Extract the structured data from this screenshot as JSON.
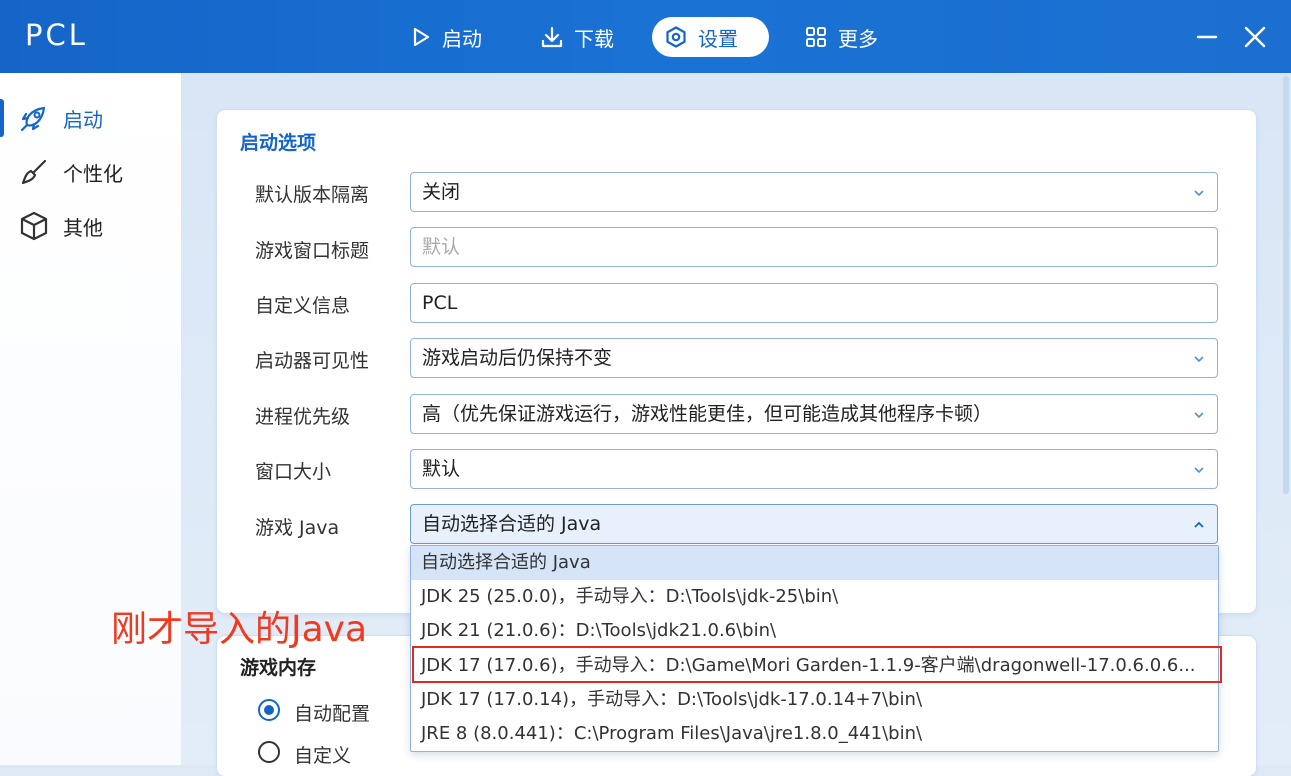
{
  "app": {
    "title": "PCL"
  },
  "nav": {
    "tabs": [
      {
        "label": "启动",
        "icon": "play-icon"
      },
      {
        "label": "下载",
        "icon": "download-icon"
      },
      {
        "label": "设置",
        "icon": "settings-icon"
      },
      {
        "label": "更多",
        "icon": "grid-icon"
      }
    ],
    "active_tab": "设置"
  },
  "sidebar": {
    "items": [
      {
        "label": "启动",
        "icon": "rocket-icon"
      },
      {
        "label": "个性化",
        "icon": "brush-icon"
      },
      {
        "label": "其他",
        "icon": "box-icon"
      }
    ],
    "active": "启动"
  },
  "launch_options": {
    "title": "启动选项",
    "rows": [
      {
        "label": "默认版本隔离",
        "value": "关闭"
      },
      {
        "label": "游戏窗口标题",
        "placeholder": "默认"
      },
      {
        "label": "自定义信息",
        "value": "PCL"
      },
      {
        "label": "启动器可见性",
        "value": "游戏启动后仍保持不变"
      },
      {
        "label": "进程优先级",
        "value": "高（优先保证游戏运行，游戏性能更佳，但可能造成其他程序卡顿）"
      },
      {
        "label": "窗口大小",
        "value": "默认"
      },
      {
        "label": "游戏 Java",
        "value": "自动选择合适的 Java"
      }
    ]
  },
  "java_dropdown": {
    "options": [
      "自动选择合适的 Java",
      "JDK 25 (25.0.0)，手动导入：D:\\Tools\\jdk-25\\bin\\",
      "JDK 21 (21.0.6)：D:\\Tools\\jdk21.0.6\\bin\\",
      "JDK 17 (17.0.6)，手动导入：D:\\Game\\Mori Garden-1.1.9-客户端\\dragonwell-17.0.6.0.6...",
      "JDK 17 (17.0.14)，手动导入：D:\\Tools\\jdk-17.0.14+7\\bin\\",
      "JRE 8 (8.0.441)：C:\\Program Files\\Java\\jre1.8.0_441\\bin\\"
    ],
    "selected_index": 0,
    "highlighted_index": 3
  },
  "annotation": {
    "text": "刚才导入的Java",
    "color": "#f03a20"
  },
  "memory": {
    "title": "游戏内存",
    "options": [
      {
        "label": "自动配置",
        "checked": true
      },
      {
        "label": "自定义",
        "checked": false
      }
    ]
  },
  "colors": {
    "accent": "#1565c8",
    "highlight": "#e02b20"
  }
}
